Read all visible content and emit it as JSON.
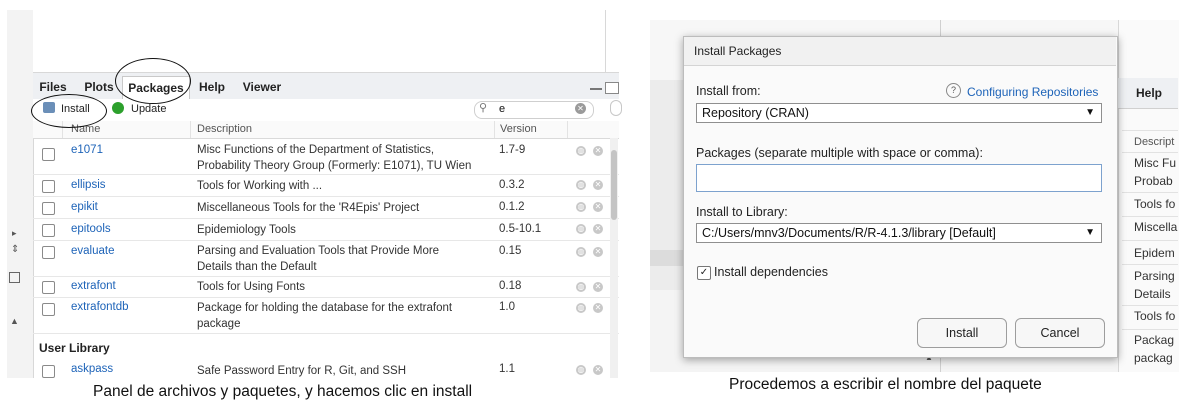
{
  "left": {
    "tabs": [
      "Files",
      "Plots",
      "Packages",
      "Help",
      "Viewer"
    ],
    "toolbar": {
      "install": "Install",
      "update": "Update",
      "search_value": "e"
    },
    "columns": {
      "name": "Name",
      "description": "Description",
      "version": "Version"
    },
    "rows": [
      {
        "name": "e1071",
        "desc1": "Misc Functions of the Department of Statistics,",
        "desc2": "Probability Theory Group (Formerly: E1071), TU Wien",
        "version": "1.7-9"
      },
      {
        "name": "ellipsis",
        "desc1": "Tools for Working with ...",
        "desc2": "",
        "version": "0.3.2"
      },
      {
        "name": "epikit",
        "desc1": "Miscellaneous Tools for the 'R4Epis' Project",
        "desc2": "",
        "version": "0.1.2"
      },
      {
        "name": "epitools",
        "desc1": "Epidemiology Tools",
        "desc2": "",
        "version": "0.5-10.1"
      },
      {
        "name": "evaluate",
        "desc1": "Parsing and Evaluation Tools that Provide More",
        "desc2": "Details than the Default",
        "version": "0.15"
      },
      {
        "name": "extrafont",
        "desc1": "Tools for Using Fonts",
        "desc2": "",
        "version": "0.18"
      },
      {
        "name": "extrafontdb",
        "desc1": "Package for holding the database for the extrafont",
        "desc2": "package",
        "version": "1.0"
      }
    ],
    "section": "User Library",
    "user_rows": [
      {
        "name": "askpass",
        "desc1": "Safe Password Entry for R, Git, and SSH",
        "version": "1.1"
      }
    ],
    "caption": "Panel de archivos y paquetes, y hacemos clic en install"
  },
  "dialog": {
    "title": "Install Packages",
    "install_from_label": "Install from:",
    "help_link": "Configuring Repositories",
    "install_from_value": "Repository (CRAN)",
    "packages_label": "Packages (separate multiple with space or comma):",
    "packages_value": "",
    "library_label": "Install to Library:",
    "library_value": "C:/Users/mnv3/Documents/R/R-4.1.3/library [Default]",
    "dependencies_label": "Install dependencies",
    "dependencies_checked": true,
    "install_button": "Install",
    "cancel_button": "Cancel"
  },
  "right_bg": {
    "help_tab": "Help",
    "col_header": "Descript",
    "cells": [
      "Misc Fu",
      "Probab",
      "Tools fo",
      "Miscella",
      "Epidem",
      "Parsing",
      "Details",
      "Tools fo",
      "Packag",
      "packag"
    ]
  },
  "right_caption": "Procedemos a escribir el nombre del paquete",
  "colors": {
    "accent": "#1d63b8",
    "tab_bg": "#eef0f3",
    "update_green": "#2ca02c",
    "focus_border": "#7da2ce"
  }
}
